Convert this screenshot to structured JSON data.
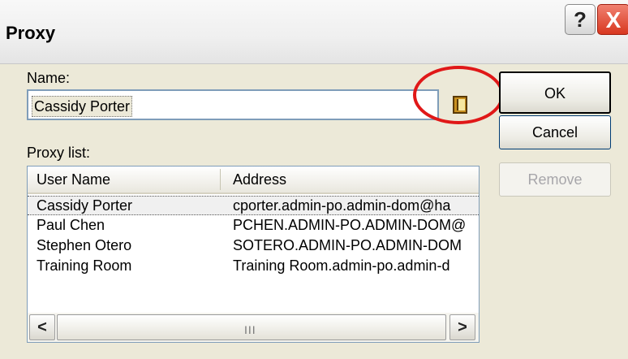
{
  "window": {
    "title": "Proxy",
    "help_glyph": "?",
    "close_glyph": "X"
  },
  "name": {
    "label": "Name:",
    "value": "Cassidy Porter"
  },
  "proxy_list": {
    "label": "Proxy list:",
    "columns": [
      "User Name",
      "Address"
    ],
    "rows": [
      {
        "user": "Cassidy Porter",
        "address": "cporter.admin-po.admin-dom@ha"
      },
      {
        "user": "Paul Chen",
        "address": "PCHEN.ADMIN-PO.ADMIN-DOM@"
      },
      {
        "user": "Stephen Otero",
        "address": "SOTERO.ADMIN-PO.ADMIN-DOM"
      },
      {
        "user": "Training Room",
        "address": "Training Room.admin-po.admin-d"
      }
    ],
    "scroll_left": "<",
    "scroll_right": ">",
    "scroll_grip": "III"
  },
  "buttons": {
    "ok": "OK",
    "cancel": "Cancel",
    "remove": "Remove"
  },
  "colors": {
    "dialog_bg": "#ece9d8",
    "callout": "#e01818",
    "close_button": "#d83820"
  },
  "icons": {
    "address_book": "address-book-icon",
    "callout": "highlight-circle"
  }
}
